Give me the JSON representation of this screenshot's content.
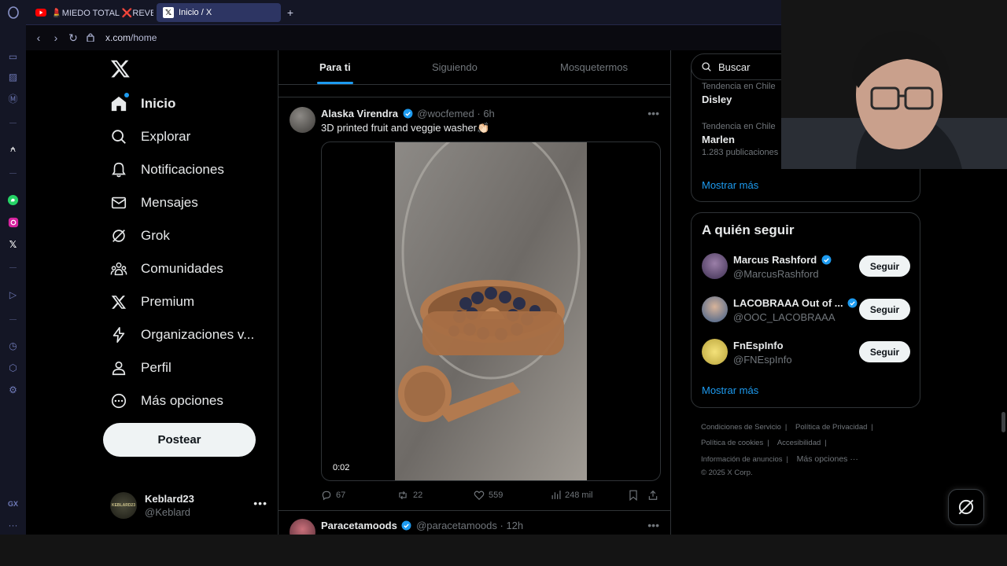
{
  "browser": {
    "tabs": [
      {
        "title": "💄MIEDO TOTAL ❌REVE",
        "active": false
      },
      {
        "title": "Inicio / X",
        "active": true
      }
    ],
    "new_tab": "+",
    "url_host": "x.com",
    "url_path": "/home",
    "sidebar_bottom_label": "GX",
    "sidebar_more": "···"
  },
  "nav": {
    "items": [
      {
        "label": "Inicio",
        "icon": "home-icon"
      },
      {
        "label": "Explorar",
        "icon": "search-icon"
      },
      {
        "label": "Notificaciones",
        "icon": "bell-icon"
      },
      {
        "label": "Mensajes",
        "icon": "mail-icon"
      },
      {
        "label": "Grok",
        "icon": "grok-icon"
      },
      {
        "label": "Comunidades",
        "icon": "people-icon"
      },
      {
        "label": "Premium",
        "icon": "x-logo-icon"
      },
      {
        "label": "Organizaciones v...",
        "icon": "lightning-icon"
      },
      {
        "label": "Perfil",
        "icon": "person-icon"
      },
      {
        "label": "Más opciones",
        "icon": "more-circle-icon"
      }
    ],
    "post_button": "Postear",
    "account": {
      "name": "Keblard23",
      "handle": "@Keblard",
      "avatar_text": "KEBLARD23"
    }
  },
  "feed": {
    "tabs": [
      "Para ti",
      "Siguiendo",
      "Mosquetermos"
    ],
    "active_tab": "Para ti",
    "tweet": {
      "name": "Alaska Virendra",
      "handle": "@wocfemed",
      "time": "· 6h",
      "text": "3D printed fruit and veggie washer👏🏻",
      "video_time": "0:02",
      "replies": "67",
      "retweets": "22",
      "likes": "559",
      "views": "248 mil"
    },
    "next_tweet": {
      "name": "Paracetamoods",
      "handle": "@paracetamoods",
      "time": "· 12h"
    }
  },
  "right": {
    "search_placeholder": "Buscar",
    "trends": [
      {
        "context": "Tendencia en Chile",
        "name": "Disley",
        "count": ""
      },
      {
        "context": "Tendencia en Chile",
        "name": "Marlen",
        "count": "1.283 publicaciones"
      }
    ],
    "trends_more": "Mostrar más",
    "who_to_follow": {
      "title": "A quién seguir",
      "users": [
        {
          "name": "Marcus Rashford",
          "handle": "@MarcusRashford",
          "verified": true
        },
        {
          "name": "LACOBRAAA Out of ...",
          "handle": "@OOC_LACOBRAAA",
          "verified": true
        },
        {
          "name": "FnEspInfo",
          "handle": "@FNEspInfo",
          "verified": false
        }
      ],
      "follow_label": "Seguir",
      "more": "Mostrar más"
    },
    "footer": {
      "links": [
        "Condiciones de Servicio",
        "Política de Privacidad",
        "Política de cookies",
        "Accesibilidad",
        "Información de anuncios",
        "Más opciones ···"
      ],
      "copyright": "© 2025 X Corp."
    }
  },
  "colors": {
    "accent": "#1d9bf0",
    "background": "#000000",
    "border": "#2f3336",
    "muted": "#71767b"
  }
}
